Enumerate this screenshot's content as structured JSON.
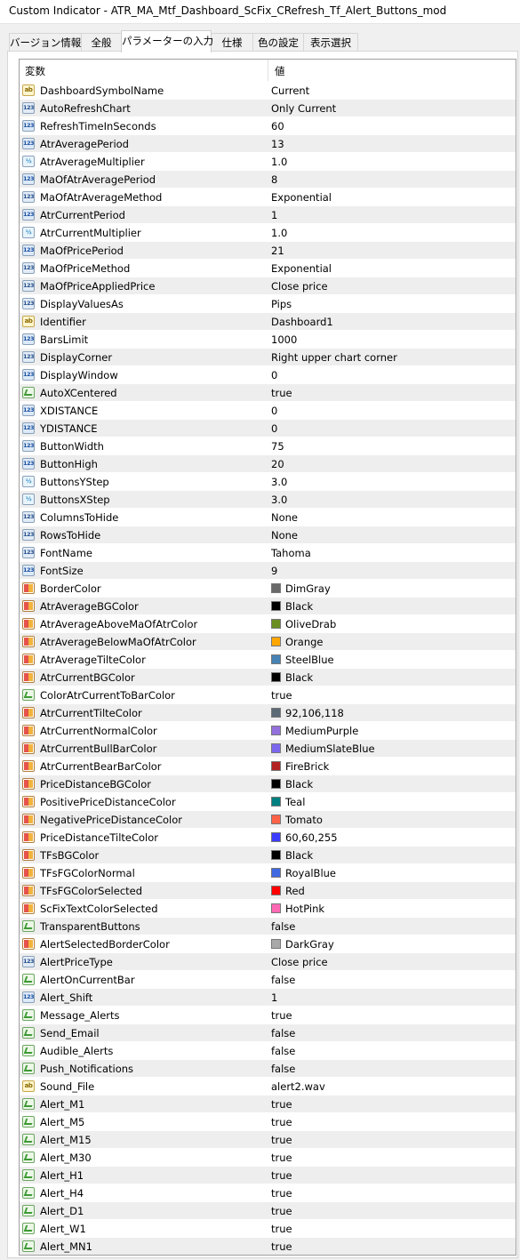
{
  "window": {
    "title": "Custom Indicator - ATR_MA_Mtf_Dashboard_ScFix_CRefresh_Tf_Alert_Buttons_mod"
  },
  "tabs": [
    {
      "label": "バージョン情報"
    },
    {
      "label": "全般"
    },
    {
      "label": "パラメーターの入力"
    },
    {
      "label": "仕様"
    },
    {
      "label": "色の設定"
    },
    {
      "label": "表示選択"
    }
  ],
  "active_tab": "パラメーターの入力",
  "grid": {
    "header": {
      "variable": "変数",
      "value": "値"
    },
    "rows": [
      {
        "type": "str",
        "icon": "ab",
        "name": "DashboardSymbolName",
        "value": "Current"
      },
      {
        "type": "enum",
        "icon": "123",
        "name": "AutoRefreshChart",
        "value": "Only Current"
      },
      {
        "type": "int",
        "icon": "123",
        "name": "RefreshTimeInSeconds",
        "value": "60"
      },
      {
        "type": "int",
        "icon": "123",
        "name": "AtrAveragePeriod",
        "value": "13"
      },
      {
        "type": "dbl",
        "icon": "½",
        "name": "AtrAverageMultiplier",
        "value": "1.0"
      },
      {
        "type": "int",
        "icon": "123",
        "name": "MaOfAtrAveragePeriod",
        "value": "8"
      },
      {
        "type": "enum",
        "icon": "123",
        "name": "MaOfAtrAverageMethod",
        "value": "Exponential"
      },
      {
        "type": "int",
        "icon": "123",
        "name": "AtrCurrentPeriod",
        "value": "1"
      },
      {
        "type": "dbl",
        "icon": "½",
        "name": "AtrCurrentMultiplier",
        "value": "1.0"
      },
      {
        "type": "int",
        "icon": "123",
        "name": "MaOfPricePeriod",
        "value": "21"
      },
      {
        "type": "enum",
        "icon": "123",
        "name": "MaOfPriceMethod",
        "value": "Exponential"
      },
      {
        "type": "enum",
        "icon": "123",
        "name": "MaOfPriceAppliedPrice",
        "value": "Close price"
      },
      {
        "type": "enum",
        "icon": "123",
        "name": "DisplayValuesAs",
        "value": "Pips"
      },
      {
        "type": "str",
        "icon": "ab",
        "name": "Identifier",
        "value": "Dashboard1"
      },
      {
        "type": "int",
        "icon": "123",
        "name": "BarsLimit",
        "value": "1000"
      },
      {
        "type": "enum",
        "icon": "123",
        "name": "DisplayCorner",
        "value": "Right upper chart corner"
      },
      {
        "type": "int",
        "icon": "123",
        "name": "DisplayWindow",
        "value": "0"
      },
      {
        "type": "bool",
        "icon": "check",
        "name": "AutoXCentered",
        "value": "true"
      },
      {
        "type": "int",
        "icon": "123",
        "name": "XDISTANCE",
        "value": "0"
      },
      {
        "type": "int",
        "icon": "123",
        "name": "YDISTANCE",
        "value": "0"
      },
      {
        "type": "int",
        "icon": "123",
        "name": "ButtonWidth",
        "value": "75"
      },
      {
        "type": "int",
        "icon": "123",
        "name": "ButtonHigh",
        "value": "20"
      },
      {
        "type": "dbl",
        "icon": "½",
        "name": "ButtonsYStep",
        "value": "3.0"
      },
      {
        "type": "dbl",
        "icon": "½",
        "name": "ButtonsXStep",
        "value": "3.0"
      },
      {
        "type": "enum",
        "icon": "123",
        "name": "ColumnsToHide",
        "value": "None"
      },
      {
        "type": "enum",
        "icon": "123",
        "name": "RowsToHide",
        "value": "None"
      },
      {
        "type": "enum",
        "icon": "123",
        "name": "FontName",
        "value": "Tahoma"
      },
      {
        "type": "int",
        "icon": "123",
        "name": "FontSize",
        "value": "9"
      },
      {
        "type": "color",
        "icon": "color",
        "name": "BorderColor",
        "value": "DimGray",
        "swatch": "#696969"
      },
      {
        "type": "color",
        "icon": "color",
        "name": "AtrAverageBGColor",
        "value": "Black",
        "swatch": "#000000"
      },
      {
        "type": "color",
        "icon": "color",
        "name": "AtrAverageAboveMaOfAtrColor",
        "value": "OliveDrab",
        "swatch": "#6b8e23"
      },
      {
        "type": "color",
        "icon": "color",
        "name": "AtrAverageBelowMaOfAtrColor",
        "value": "Orange",
        "swatch": "#ffa500"
      },
      {
        "type": "color",
        "icon": "color",
        "name": "AtrAverageTilteColor",
        "value": "SteelBlue",
        "swatch": "#4682b4"
      },
      {
        "type": "color",
        "icon": "color",
        "name": "AtrCurrentBGColor",
        "value": "Black",
        "swatch": "#000000"
      },
      {
        "type": "bool",
        "icon": "check",
        "name": "ColorAtrCurrentToBarColor",
        "value": "true"
      },
      {
        "type": "color",
        "icon": "color",
        "name": "AtrCurrentTilteColor",
        "value": "92,106,118",
        "swatch": "#5c6a76"
      },
      {
        "type": "color",
        "icon": "color",
        "name": "AtrCurrentNormalColor",
        "value": "MediumPurple",
        "swatch": "#9370db"
      },
      {
        "type": "color",
        "icon": "color",
        "name": "AtrCurrentBullBarColor",
        "value": "MediumSlateBlue",
        "swatch": "#7b68ee"
      },
      {
        "type": "color",
        "icon": "color",
        "name": "AtrCurrentBearBarColor",
        "value": "FireBrick",
        "swatch": "#b22222"
      },
      {
        "type": "color",
        "icon": "color",
        "name": "PriceDistanceBGColor",
        "value": "Black",
        "swatch": "#000000"
      },
      {
        "type": "color",
        "icon": "color",
        "name": "PositivePriceDistanceColor",
        "value": "Teal",
        "swatch": "#008080"
      },
      {
        "type": "color",
        "icon": "color",
        "name": "NegativePriceDistanceColor",
        "value": "Tomato",
        "swatch": "#ff6347"
      },
      {
        "type": "color",
        "icon": "color",
        "name": "PriceDistanceTilteColor",
        "value": "60,60,255",
        "swatch": "#3c3cff"
      },
      {
        "type": "color",
        "icon": "color",
        "name": "TFsBGColor",
        "value": "Black",
        "swatch": "#000000"
      },
      {
        "type": "color",
        "icon": "color",
        "name": "TFsFGColorNormal",
        "value": "RoyalBlue",
        "swatch": "#4169e1"
      },
      {
        "type": "color",
        "icon": "color",
        "name": "TFsFGColorSelected",
        "value": "Red",
        "swatch": "#ff0000"
      },
      {
        "type": "color",
        "icon": "color",
        "name": "ScFixTextColorSelected",
        "value": "HotPink",
        "swatch": "#ff69b4"
      },
      {
        "type": "bool",
        "icon": "check",
        "name": "TransparentButtons",
        "value": "false"
      },
      {
        "type": "color",
        "icon": "color",
        "name": "AlertSelectedBorderColor",
        "value": "DarkGray",
        "swatch": "#a9a9a9"
      },
      {
        "type": "enum",
        "icon": "123",
        "name": "AlertPriceType",
        "value": "Close price"
      },
      {
        "type": "bool",
        "icon": "check",
        "name": "AlertOnCurrentBar",
        "value": "false"
      },
      {
        "type": "int",
        "icon": "123",
        "name": "Alert_Shift",
        "value": "1"
      },
      {
        "type": "bool",
        "icon": "check",
        "name": "Message_Alerts",
        "value": "true"
      },
      {
        "type": "bool",
        "icon": "check",
        "name": "Send_Email",
        "value": "false"
      },
      {
        "type": "bool",
        "icon": "check",
        "name": "Audible_Alerts",
        "value": "false"
      },
      {
        "type": "bool",
        "icon": "check",
        "name": "Push_Notifications",
        "value": "false"
      },
      {
        "type": "str",
        "icon": "ab",
        "name": "Sound_File",
        "value": "alert2.wav"
      },
      {
        "type": "bool",
        "icon": "check",
        "name": "Alert_M1",
        "value": "true"
      },
      {
        "type": "bool",
        "icon": "check",
        "name": "Alert_M5",
        "value": "true"
      },
      {
        "type": "bool",
        "icon": "check",
        "name": "Alert_M15",
        "value": "true"
      },
      {
        "type": "bool",
        "icon": "check",
        "name": "Alert_M30",
        "value": "true"
      },
      {
        "type": "bool",
        "icon": "check",
        "name": "Alert_H1",
        "value": "true"
      },
      {
        "type": "bool",
        "icon": "check",
        "name": "Alert_H4",
        "value": "true"
      },
      {
        "type": "bool",
        "icon": "check",
        "name": "Alert_D1",
        "value": "true"
      },
      {
        "type": "bool",
        "icon": "check",
        "name": "Alert_W1",
        "value": "true"
      },
      {
        "type": "bool",
        "icon": "check",
        "name": "Alert_MN1",
        "value": "true"
      }
    ]
  }
}
